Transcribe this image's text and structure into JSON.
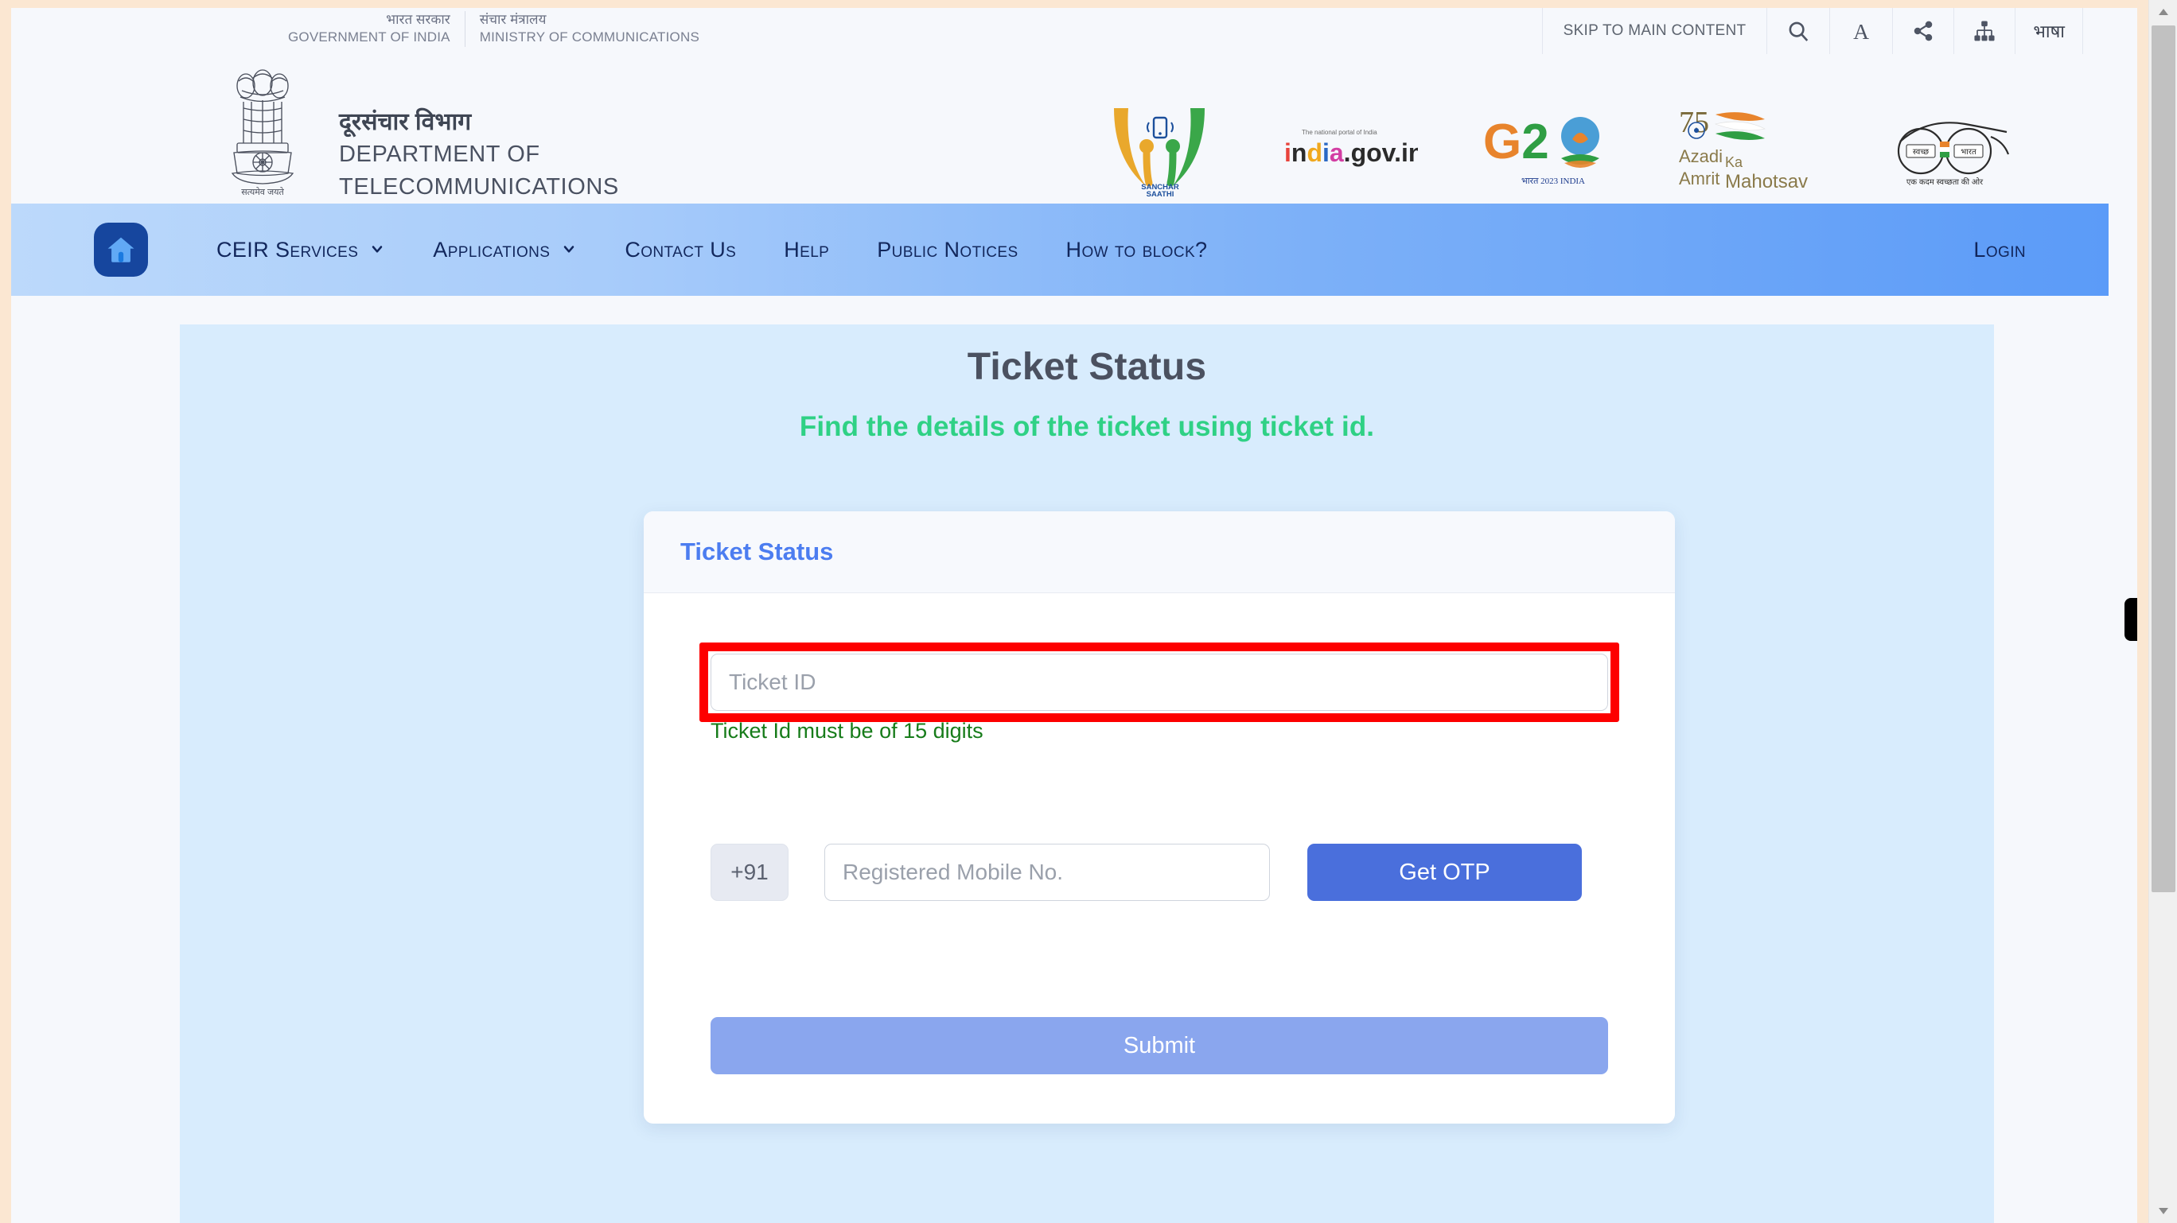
{
  "topbar": {
    "gov": {
      "hindi_1": "भारत सरकार",
      "english_1": "GOVERNMENT OF INDIA",
      "hindi_2": "संचार मंत्रालय",
      "english_2": "MINISTRY OF COMMUNICATIONS"
    },
    "skip_link": "SKIP TO MAIN CONTENT",
    "icons": [
      "search-icon",
      "font-size-icon",
      "share-icon",
      "sitemap-icon"
    ],
    "language_label": "भाषा"
  },
  "brand": {
    "emblem": "state-emblem-of-india",
    "emblem_motto": "सत्यमेव जयते",
    "hindi": "दूरसंचार विभाग",
    "english_line1": "DEPARTMENT OF",
    "english_line2": "TELECOMMUNICATIONS",
    "logos": [
      {
        "name": "sanchar-saathi-logo",
        "caption1": "SANCHAR",
        "caption2": "SAATHI"
      },
      {
        "name": "india-gov-in-logo",
        "tagline": "The national portal of India",
        "text": "india.gov.in"
      },
      {
        "name": "g20-india-logo",
        "text": "G20",
        "caption": "भारत 2023 INDIA"
      },
      {
        "name": "azadi-ka-amrit-mahotsav-logo",
        "num": "75",
        "line1": "Azadi",
        "line2": "Ka",
        "line3": "Amrit",
        "line4": "Mahotsav"
      },
      {
        "name": "swachh-bharat-logo",
        "inner1": "स्वच्छ",
        "inner2": "भारत",
        "caption": "एक कदम स्वच्छता की ओर"
      }
    ]
  },
  "nav": {
    "home_icon": "home-icon",
    "items": [
      {
        "label": "CEIR Services",
        "has_dropdown": true
      },
      {
        "label": "Applications",
        "has_dropdown": true
      },
      {
        "label": "Contact Us",
        "has_dropdown": false
      },
      {
        "label": "Help",
        "has_dropdown": false
      },
      {
        "label": "Public Notices",
        "has_dropdown": false
      },
      {
        "label": "How to block?",
        "has_dropdown": false
      }
    ],
    "login_label": "Login"
  },
  "page": {
    "title": "Ticket Status",
    "subtitle": "Find the details of the ticket using ticket id."
  },
  "card": {
    "header_title": "Ticket Status",
    "ticket_input": {
      "value": "",
      "placeholder": "Ticket ID"
    },
    "validation_message": "Ticket Id must be of 15 digits",
    "country_code": "+91",
    "mobile_input": {
      "value": "",
      "placeholder": "Registered Mobile No."
    },
    "get_otp_label": "Get OTP",
    "submit_label": "Submit"
  },
  "colors": {
    "accent_blue": "#4c7df0",
    "subtitle_green": "#2fd185",
    "validation_green": "#177c1a",
    "highlight_red": "#fd0000",
    "otp_button": "#4a6fdc",
    "submit_button": "#8aa6ee",
    "panel_background": "#d8ecfd",
    "nav_gradient_start": "#bcd9fb",
    "nav_gradient_end": "#5b9bf8"
  },
  "scrollbar": {
    "position": "near-top"
  }
}
